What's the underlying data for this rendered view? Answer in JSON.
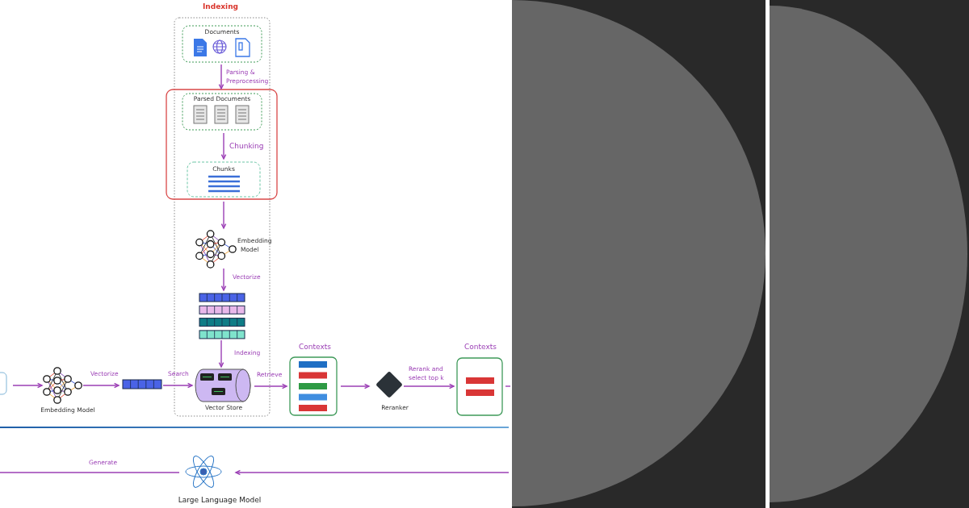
{
  "indexing_title": "Indexing",
  "documents": "Documents",
  "parsing": [
    "Parsing  &",
    "Preprocessing"
  ],
  "parsed_documents": "Parsed Documents",
  "chunking": "Chunking",
  "chunks": "Chunks",
  "embedding_model_top": [
    "Embedding",
    "Model"
  ],
  "vectorize_top": "Vectorize",
  "vector_rows": [
    {
      "color": "#4a63e6"
    },
    {
      "color": "#e9b8ea"
    },
    {
      "color": "#0f7c86"
    },
    {
      "color": "#7fe3cc"
    }
  ],
  "indexing_step": "Indexing",
  "embedding_model_bottom": "Embedding Model",
  "vectorize_bottom": "Vectorize",
  "search": "Search",
  "vector_store": "Vector Store",
  "retrieve": "Retrieve",
  "contexts_retrieved": {
    "title": "Contexts",
    "bars": [
      {
        "color": "#1f6fc4"
      },
      {
        "color": "#d93636"
      },
      {
        "color": "#2e9a44"
      },
      {
        "color": "#3f8de0"
      },
      {
        "color": "#d93636"
      }
    ]
  },
  "reranker": "Reranker",
  "rerank": [
    "Rerank and",
    "select top k"
  ],
  "contexts_selected": {
    "title": "Contexts",
    "bars": [
      {
        "color": "#d93636"
      },
      {
        "color": "#d93636"
      }
    ]
  },
  "generate": "Generate",
  "llm": "Large Language Model"
}
